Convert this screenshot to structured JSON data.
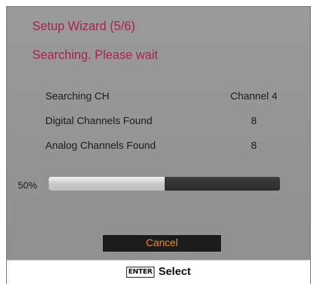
{
  "dialog": {
    "title": "Setup Wizard (5/6)",
    "status": "Searching. Please wait"
  },
  "scan": {
    "rows": [
      {
        "label": "Searching CH",
        "value": "Channel 4"
      },
      {
        "label": "Digital Channels Found",
        "value": "8"
      },
      {
        "label": "Analog Channels Found",
        "value": "8"
      }
    ]
  },
  "progress": {
    "label": "50%",
    "fraction": 0.5
  },
  "buttons": {
    "cancel_label": "Cancel"
  },
  "footer": {
    "key_label": "ENTER",
    "action_label": "Select"
  },
  "colors": {
    "title_text": "#a8234f",
    "button_text": "#f08a1a",
    "panel_background": "#959595"
  }
}
